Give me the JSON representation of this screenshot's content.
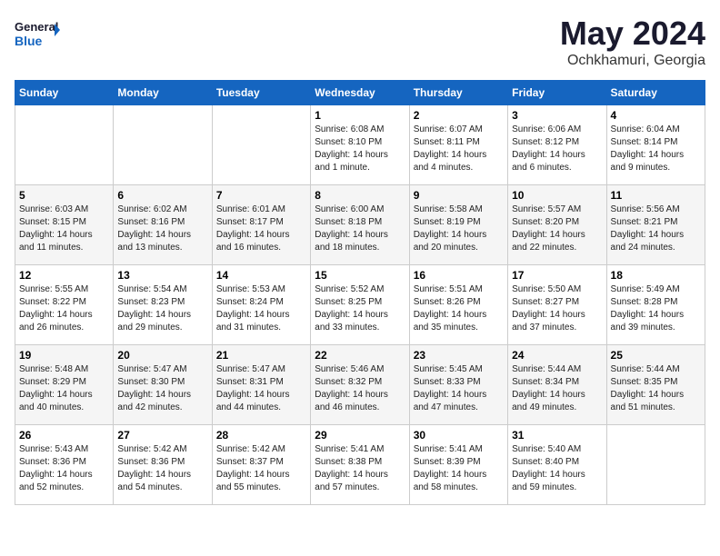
{
  "logo": {
    "line1": "General",
    "line2": "Blue"
  },
  "title": "May 2024",
  "subtitle": "Ochkhamuri, Georgia",
  "headers": [
    "Sunday",
    "Monday",
    "Tuesday",
    "Wednesday",
    "Thursday",
    "Friday",
    "Saturday"
  ],
  "weeks": [
    [
      {
        "day": "",
        "info": ""
      },
      {
        "day": "",
        "info": ""
      },
      {
        "day": "",
        "info": ""
      },
      {
        "day": "1",
        "info": "Sunrise: 6:08 AM\nSunset: 8:10 PM\nDaylight: 14 hours\nand 1 minute."
      },
      {
        "day": "2",
        "info": "Sunrise: 6:07 AM\nSunset: 8:11 PM\nDaylight: 14 hours\nand 4 minutes."
      },
      {
        "day": "3",
        "info": "Sunrise: 6:06 AM\nSunset: 8:12 PM\nDaylight: 14 hours\nand 6 minutes."
      },
      {
        "day": "4",
        "info": "Sunrise: 6:04 AM\nSunset: 8:14 PM\nDaylight: 14 hours\nand 9 minutes."
      }
    ],
    [
      {
        "day": "5",
        "info": "Sunrise: 6:03 AM\nSunset: 8:15 PM\nDaylight: 14 hours\nand 11 minutes."
      },
      {
        "day": "6",
        "info": "Sunrise: 6:02 AM\nSunset: 8:16 PM\nDaylight: 14 hours\nand 13 minutes."
      },
      {
        "day": "7",
        "info": "Sunrise: 6:01 AM\nSunset: 8:17 PM\nDaylight: 14 hours\nand 16 minutes."
      },
      {
        "day": "8",
        "info": "Sunrise: 6:00 AM\nSunset: 8:18 PM\nDaylight: 14 hours\nand 18 minutes."
      },
      {
        "day": "9",
        "info": "Sunrise: 5:58 AM\nSunset: 8:19 PM\nDaylight: 14 hours\nand 20 minutes."
      },
      {
        "day": "10",
        "info": "Sunrise: 5:57 AM\nSunset: 8:20 PM\nDaylight: 14 hours\nand 22 minutes."
      },
      {
        "day": "11",
        "info": "Sunrise: 5:56 AM\nSunset: 8:21 PM\nDaylight: 14 hours\nand 24 minutes."
      }
    ],
    [
      {
        "day": "12",
        "info": "Sunrise: 5:55 AM\nSunset: 8:22 PM\nDaylight: 14 hours\nand 26 minutes."
      },
      {
        "day": "13",
        "info": "Sunrise: 5:54 AM\nSunset: 8:23 PM\nDaylight: 14 hours\nand 29 minutes."
      },
      {
        "day": "14",
        "info": "Sunrise: 5:53 AM\nSunset: 8:24 PM\nDaylight: 14 hours\nand 31 minutes."
      },
      {
        "day": "15",
        "info": "Sunrise: 5:52 AM\nSunset: 8:25 PM\nDaylight: 14 hours\nand 33 minutes."
      },
      {
        "day": "16",
        "info": "Sunrise: 5:51 AM\nSunset: 8:26 PM\nDaylight: 14 hours\nand 35 minutes."
      },
      {
        "day": "17",
        "info": "Sunrise: 5:50 AM\nSunset: 8:27 PM\nDaylight: 14 hours\nand 37 minutes."
      },
      {
        "day": "18",
        "info": "Sunrise: 5:49 AM\nSunset: 8:28 PM\nDaylight: 14 hours\nand 39 minutes."
      }
    ],
    [
      {
        "day": "19",
        "info": "Sunrise: 5:48 AM\nSunset: 8:29 PM\nDaylight: 14 hours\nand 40 minutes."
      },
      {
        "day": "20",
        "info": "Sunrise: 5:47 AM\nSunset: 8:30 PM\nDaylight: 14 hours\nand 42 minutes."
      },
      {
        "day": "21",
        "info": "Sunrise: 5:47 AM\nSunset: 8:31 PM\nDaylight: 14 hours\nand 44 minutes."
      },
      {
        "day": "22",
        "info": "Sunrise: 5:46 AM\nSunset: 8:32 PM\nDaylight: 14 hours\nand 46 minutes."
      },
      {
        "day": "23",
        "info": "Sunrise: 5:45 AM\nSunset: 8:33 PM\nDaylight: 14 hours\nand 47 minutes."
      },
      {
        "day": "24",
        "info": "Sunrise: 5:44 AM\nSunset: 8:34 PM\nDaylight: 14 hours\nand 49 minutes."
      },
      {
        "day": "25",
        "info": "Sunrise: 5:44 AM\nSunset: 8:35 PM\nDaylight: 14 hours\nand 51 minutes."
      }
    ],
    [
      {
        "day": "26",
        "info": "Sunrise: 5:43 AM\nSunset: 8:36 PM\nDaylight: 14 hours\nand 52 minutes."
      },
      {
        "day": "27",
        "info": "Sunrise: 5:42 AM\nSunset: 8:36 PM\nDaylight: 14 hours\nand 54 minutes."
      },
      {
        "day": "28",
        "info": "Sunrise: 5:42 AM\nSunset: 8:37 PM\nDaylight: 14 hours\nand 55 minutes."
      },
      {
        "day": "29",
        "info": "Sunrise: 5:41 AM\nSunset: 8:38 PM\nDaylight: 14 hours\nand 57 minutes."
      },
      {
        "day": "30",
        "info": "Sunrise: 5:41 AM\nSunset: 8:39 PM\nDaylight: 14 hours\nand 58 minutes."
      },
      {
        "day": "31",
        "info": "Sunrise: 5:40 AM\nSunset: 8:40 PM\nDaylight: 14 hours\nand 59 minutes."
      },
      {
        "day": "",
        "info": ""
      }
    ]
  ]
}
